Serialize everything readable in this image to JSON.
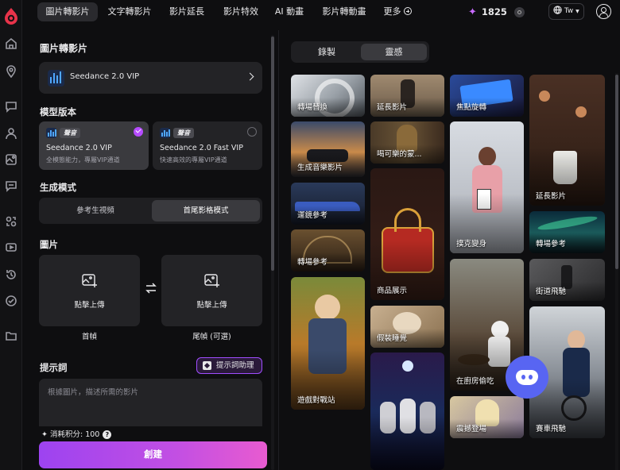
{
  "nav": {
    "tabs": [
      "圖片轉影片",
      "文字轉影片",
      "影片延長",
      "影片特效",
      "AI 動畫",
      "影片轉動畫",
      "更多"
    ],
    "credits": "1825",
    "lang": "Tw"
  },
  "panel": {
    "title": "圖片轉影片",
    "model": "Seedance 2.0 VIP",
    "version_label": "模型版本",
    "versions": [
      {
        "badge": "聲音",
        "title": "Seedance 2.0 VIP",
        "sub": "全模態能力，專屬VIP通道"
      },
      {
        "badge": "聲音",
        "title": "Seedance 2.0 Fast VIP",
        "sub": "快速高效的專屬VIP通道"
      }
    ],
    "mode_label": "生成模式",
    "modes": [
      "參考生視頻",
      "首尾影格模式"
    ],
    "image_label": "圖片",
    "upload_text": "點擊上傳",
    "first_frame": "首幀",
    "last_frame": "尾幀 (可選)",
    "prompt_label": "提示詞",
    "assistant": "提示詞助理",
    "prompt_placeholder": "根據圖片，描述所需的影片",
    "cost": "消耗积分: 100",
    "help": "?",
    "create": "創建"
  },
  "gallery": {
    "tabs": [
      "錄製",
      "靈感"
    ],
    "cards": [
      "轉場替換",
      "延長影片",
      "焦點旋轉",
      "延長影片",
      "生成音樂影片",
      "喝可樂的蒙...",
      "撲克變身",
      "轉場參考",
      "運鏡參考",
      "轉場參考",
      "商品展示",
      "街道飛馳",
      "遊戲對戰站",
      "假裝睡覺",
      "在廚房偷吃",
      "震撼登場",
      "賽車飛馳"
    ]
  },
  "colors": {
    "accent": "#b64cff",
    "discord": "#5865f2"
  }
}
